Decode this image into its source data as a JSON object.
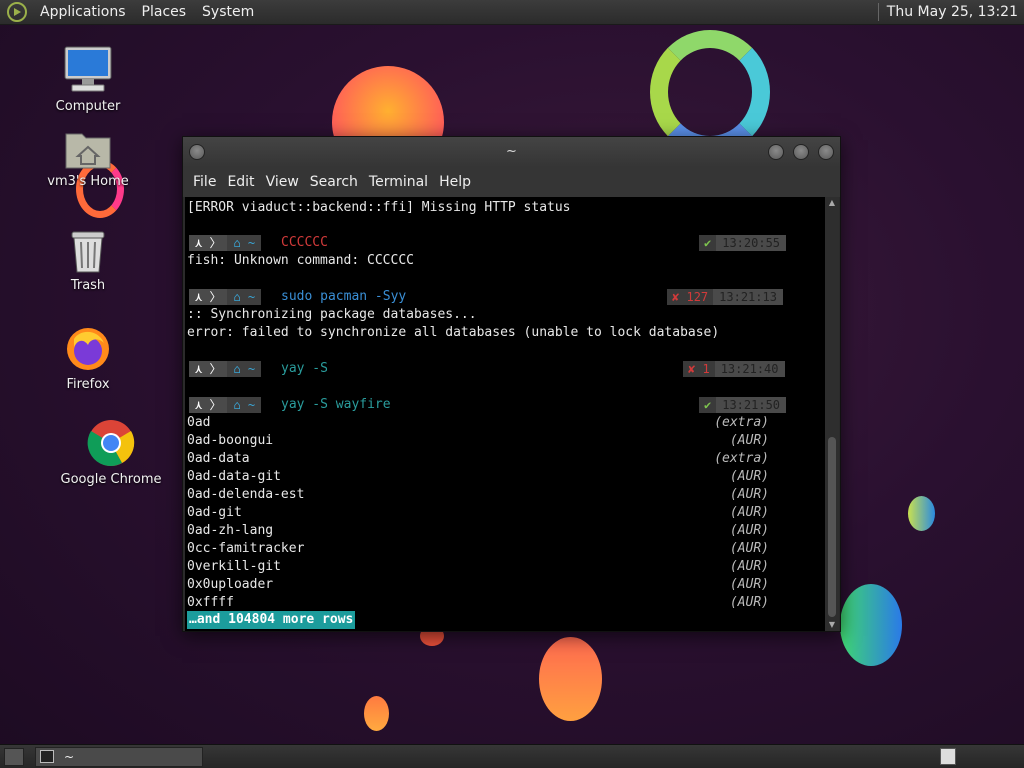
{
  "top_panel": {
    "menus": [
      "Applications",
      "Places",
      "System"
    ],
    "clock": "Thu May 25, 13:21"
  },
  "desktop_icons": [
    {
      "label": "Computer",
      "icon": "computer-icon"
    },
    {
      "label": "vm3's Home",
      "icon": "home-folder-icon"
    },
    {
      "label": "Trash",
      "icon": "trash-icon"
    },
    {
      "label": "Firefox",
      "icon": "firefox-icon"
    },
    {
      "label": "Google Chrome",
      "icon": "chrome-icon"
    }
  ],
  "terminal": {
    "title": "~",
    "menus": [
      "File",
      "Edit",
      "View",
      "Search",
      "Terminal",
      "Help"
    ],
    "first_line": "[ERROR viaduct::backend::ffi] Missing HTTP status",
    "prompt_home": "~",
    "commands": [
      {
        "cmd": "CCCCCC",
        "cmd_color": "#d23a3a",
        "status": "ok",
        "code": "",
        "time": "13:20:55",
        "output": [
          "fish: Unknown command: CCCCCC"
        ]
      },
      {
        "cmd": "sudo pacman -Syy",
        "cmd_color": "#3a8fd6",
        "status": "err",
        "code": "127",
        "time": "13:21:13",
        "output": [
          ":: Synchronizing package databases...",
          "error: failed to synchronize all databases (unable to lock database)"
        ]
      },
      {
        "cmd": "yay -S",
        "cmd_color": "#2a9d9d",
        "status": "err",
        "code": "1",
        "time": "13:21:40",
        "output": []
      },
      {
        "cmd": "yay -S wayfire",
        "cmd_color": "#2a9d9d",
        "status": "ok",
        "code": "",
        "time": "13:21:50",
        "output": []
      }
    ],
    "status_ok_glyph": "✔",
    "status_err_glyph": "✘",
    "packages": [
      {
        "name": "0ad",
        "repo": "(extra)"
      },
      {
        "name": "0ad-boongui",
        "repo": "(AUR)"
      },
      {
        "name": "0ad-data",
        "repo": "(extra)"
      },
      {
        "name": "0ad-data-git",
        "repo": "(AUR)"
      },
      {
        "name": "0ad-delenda-est",
        "repo": "(AUR)"
      },
      {
        "name": "0ad-git",
        "repo": "(AUR)"
      },
      {
        "name": "0ad-zh-lang",
        "repo": "(AUR)"
      },
      {
        "name": "0cc-famitracker",
        "repo": "(AUR)"
      },
      {
        "name": "0verkill-git",
        "repo": "(AUR)"
      },
      {
        "name": "0x0uploader",
        "repo": "(AUR)"
      },
      {
        "name": "0xffff",
        "repo": "(AUR)"
      }
    ],
    "more_rows": "…and 104804 more rows"
  },
  "taskbar": {
    "task_label": "~"
  }
}
